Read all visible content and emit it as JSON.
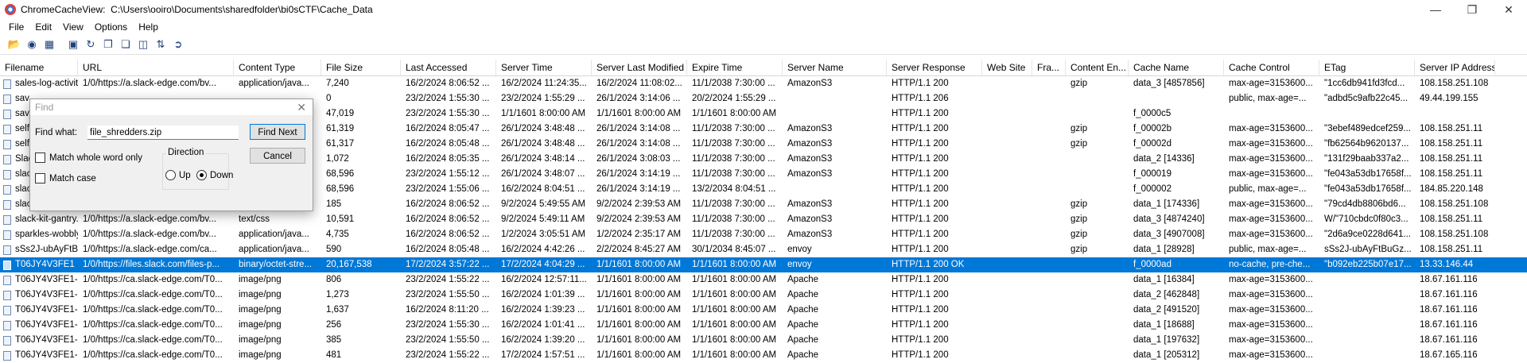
{
  "window": {
    "app_name": "ChromeCacheView:",
    "path": "C:\\Users\\ooiro\\Documents\\sharedfolder\\bi0sCTF\\Cache_Data",
    "minimize": "—",
    "maximize": "❐",
    "close": "✕"
  },
  "menu": [
    "File",
    "Edit",
    "View",
    "Options",
    "Help"
  ],
  "toolbar_icons": [
    "open-icon",
    "browser-icon",
    "folder-icon",
    "save-icon",
    "refresh-icon",
    "copy-icon",
    "copy-all-icon",
    "properties-icon",
    "sort-icon",
    "exit-icon"
  ],
  "columns": [
    {
      "label": "Filename",
      "w": 98
    },
    {
      "label": "URL",
      "w": 196
    },
    {
      "label": "Content Type",
      "w": 110
    },
    {
      "label": "File Size",
      "w": 100
    },
    {
      "label": "Last Accessed",
      "w": 120
    },
    {
      "label": "Server Time",
      "w": 120
    },
    {
      "label": "Server Last Modified",
      "w": 120
    },
    {
      "label": "Expire Time",
      "w": 120
    },
    {
      "label": "Server Name",
      "w": 131
    },
    {
      "label": "Server Response",
      "w": 120
    },
    {
      "label": "Web Site",
      "w": 63
    },
    {
      "label": "Fra...",
      "w": 42
    },
    {
      "label": "Content En...",
      "w": 79
    },
    {
      "label": "Cache Name",
      "w": 120
    },
    {
      "label": "Cache Control",
      "w": 120
    },
    {
      "label": "ETag",
      "w": 120
    },
    {
      "label": "Server IP Address",
      "w": 101
    }
  ],
  "rows": [
    {
      "sel": false,
      "cells": [
        "sales-log-activit...",
        "1/0/https://a.slack-edge.com/bv...",
        "application/java...",
        "7,240",
        "16/2/2024 8:06:52 ...",
        "16/2/2024 11:24:35...",
        "16/2/2024 11:08:02...",
        "11/1/2038 7:30:00 ...",
        "AmazonS3",
        "HTTP/1.1 200",
        "",
        "",
        "gzip",
        "data_3 [4857856]",
        "max-age=3153600...",
        "\"1cc6db941fd3fcd...",
        "108.158.251.108"
      ]
    },
    {
      "sel": false,
      "cells": [
        "sav",
        "",
        "",
        "0",
        "23/2/2024 1:55:30 ...",
        "23/2/2024 1:55:29 ...",
        "26/1/2024 3:14:06 ...",
        "20/2/2024 1:55:29 ...",
        "",
        "HTTP/1.1 206",
        "",
        "",
        "",
        "",
        "public, max-age=...",
        "\"adbd5c9afb22c45...",
        "49.44.199.155"
      ]
    },
    {
      "sel": false,
      "cells": [
        "sav",
        "",
        "",
        "47,019",
        "23/2/2024 1:55:30 ...",
        "1/1/1601 8:00:00 AM",
        "1/1/1601 8:00:00 AM",
        "1/1/1601 8:00:00 AM",
        "",
        "HTTP/1.1 200",
        "",
        "",
        "",
        "f_0000c5",
        "",
        "",
        ""
      ]
    },
    {
      "sel": false,
      "cells": [
        "self",
        "",
        "ava...",
        "61,319",
        "16/2/2024 8:05:47 ...",
        "26/1/2024 3:48:48 ...",
        "26/1/2024 3:14:08 ...",
        "11/1/2038 7:30:00 ...",
        "AmazonS3",
        "HTTP/1.1 200",
        "",
        "",
        "gzip",
        "f_00002b",
        "max-age=3153600...",
        "\"3ebef489edcef259...",
        "108.158.251.11"
      ]
    },
    {
      "sel": false,
      "cells": [
        "self",
        "",
        "ava...",
        "61,317",
        "16/2/2024 8:05:48 ...",
        "26/1/2024 3:48:48 ...",
        "26/1/2024 3:14:08 ...",
        "11/1/2038 7:30:00 ...",
        "AmazonS3",
        "HTTP/1.1 200",
        "",
        "",
        "gzip",
        "f_00002d",
        "max-age=3153600...",
        "\"fb62564b9620137...",
        "108.158.251.11"
      ]
    },
    {
      "sel": false,
      "cells": [
        "Slad",
        "",
        "",
        "1,072",
        "16/2/2024 8:05:35 ...",
        "26/1/2024 3:48:14 ...",
        "26/1/2024 3:08:03 ...",
        "11/1/2038 7:30:00 ...",
        "AmazonS3",
        "HTTP/1.1 200",
        "",
        "",
        "",
        "data_2 [14336]",
        "max-age=3153600...",
        "\"131f29baab337a2...",
        "108.158.251.11"
      ]
    },
    {
      "sel": false,
      "cells": [
        "slac",
        "",
        "",
        "68,596",
        "23/2/2024 1:55:12 ...",
        "26/1/2024 3:48:07 ...",
        "26/1/2024 3:14:19 ...",
        "11/1/2038 7:30:00 ...",
        "AmazonS3",
        "HTTP/1.1 200",
        "",
        "",
        "",
        "f_000019",
        "max-age=3153600...",
        "\"fe043a53db17658f...",
        "108.158.251.11"
      ]
    },
    {
      "sel": false,
      "cells": [
        "slac",
        "",
        "",
        "68,596",
        "23/2/2024 1:55:06 ...",
        "16/2/2024 8:04:51 ...",
        "26/1/2024 3:14:19 ...",
        "13/2/2034 8:04:51 ...",
        "",
        "HTTP/1.1 200",
        "",
        "",
        "",
        "f_000002",
        "public, max-age=...",
        "\"fe043a53db17658f...",
        "184.85.220.148"
      ]
    },
    {
      "sel": false,
      "cells": [
        "slac",
        "",
        "ava...",
        "185",
        "16/2/2024 8:06:52 ...",
        "9/2/2024 5:49:55 AM",
        "9/2/2024 2:39:53 AM",
        "11/1/2038 7:30:00 ...",
        "AmazonS3",
        "HTTP/1.1 200",
        "",
        "",
        "gzip",
        "data_1 [174336]",
        "max-age=3153600...",
        "\"79cd4db8806bd6...",
        "108.158.251.108"
      ]
    },
    {
      "sel": false,
      "cells": [
        "slack-kit-gantry...",
        "1/0/https://a.slack-edge.com/bv...",
        "text/css",
        "10,591",
        "16/2/2024 8:06:52 ...",
        "9/2/2024 5:49:11 AM",
        "9/2/2024 2:39:53 AM",
        "11/1/2038 7:30:00 ...",
        "AmazonS3",
        "HTTP/1.1 200",
        "",
        "",
        "gzip",
        "data_3 [4874240]",
        "max-age=3153600...",
        "W/\"710cbdc0f80c3...",
        "108.158.251.11"
      ]
    },
    {
      "sel": false,
      "cells": [
        "sparkles-wobbly...",
        "1/0/https://a.slack-edge.com/bv...",
        "application/java...",
        "4,735",
        "16/2/2024 8:06:52 ...",
        "1/2/2024 3:05:51 AM",
        "1/2/2024 2:35:17 AM",
        "11/1/2038 7:30:00 ...",
        "AmazonS3",
        "HTTP/1.1 200",
        "",
        "",
        "gzip",
        "data_3 [4907008]",
        "max-age=3153600...",
        "\"2d6a9ce0228d641...",
        "108.158.251.108"
      ]
    },
    {
      "sel": false,
      "cells": [
        "sSs2J-ubAyFtBu...",
        "1/0/https://a.slack-edge.com/ca...",
        "application/java...",
        "590",
        "16/2/2024 8:05:48 ...",
        "16/2/2024 4:42:26 ...",
        "2/2/2024 8:45:27 AM",
        "30/1/2034 8:45:07 ...",
        "envoy",
        "HTTP/1.1 200",
        "",
        "",
        "gzip",
        "data_1 [28928]",
        "public, max-age=...",
        "sSs2J-ubAyFtBuGz...",
        "108.158.251.11"
      ]
    },
    {
      "sel": true,
      "cells": [
        "T06JY4V3FE1",
        "1/0/https://files.slack.com/files-p...",
        "binary/octet-stre...",
        "20,167,538",
        "17/2/2024 3:57:22 ...",
        "17/2/2024 4:04:29 ...",
        "1/1/1601 8:00:00 AM",
        "1/1/1601 8:00:00 AM",
        "envoy",
        "HTTP/1.1 200 OK",
        "",
        "",
        "",
        "f_0000ad",
        "no-cache, pre-che...",
        "\"b092eb225b07e17...",
        "13.33.146.44"
      ]
    },
    {
      "sel": false,
      "cells": [
        "T06JY4V3FE1-U0...",
        "1/0/https://ca.slack-edge.com/T0...",
        "image/png",
        "806",
        "23/2/2024 1:55:22 ...",
        "16/2/2024 12:57:11...",
        "1/1/1601 8:00:00 AM",
        "1/1/1601 8:00:00 AM",
        "Apache",
        "HTTP/1.1 200",
        "",
        "",
        "",
        "data_1 [16384]",
        "max-age=3153600...",
        "",
        "18.67.161.116"
      ]
    },
    {
      "sel": false,
      "cells": [
        "T06JY4V3FE1-U0...",
        "1/0/https://ca.slack-edge.com/T0...",
        "image/png",
        "1,273",
        "23/2/2024 1:55:50 ...",
        "16/2/2024 1:01:39 ...",
        "1/1/1601 8:00:00 AM",
        "1/1/1601 8:00:00 AM",
        "Apache",
        "HTTP/1.1 200",
        "",
        "",
        "",
        "data_2 [462848]",
        "max-age=3153600...",
        "",
        "18.67.161.116"
      ]
    },
    {
      "sel": false,
      "cells": [
        "T06JY4V3FE1-U0...",
        "1/0/https://ca.slack-edge.com/T0...",
        "image/png",
        "1,637",
        "16/2/2024 8:11:20 ...",
        "16/2/2024 1:39:23 ...",
        "1/1/1601 8:00:00 AM",
        "1/1/1601 8:00:00 AM",
        "Apache",
        "HTTP/1.1 200",
        "",
        "",
        "",
        "data_2 [491520]",
        "max-age=3153600...",
        "",
        "18.67.161.116"
      ]
    },
    {
      "sel": false,
      "cells": [
        "T06JY4V3FE1-U0...",
        "1/0/https://ca.slack-edge.com/T0...",
        "image/png",
        "256",
        "23/2/2024 1:55:30 ...",
        "16/2/2024 1:01:41 ...",
        "1/1/1601 8:00:00 AM",
        "1/1/1601 8:00:00 AM",
        "Apache",
        "HTTP/1.1 200",
        "",
        "",
        "",
        "data_1 [18688]",
        "max-age=3153600...",
        "",
        "18.67.161.116"
      ]
    },
    {
      "sel": false,
      "cells": [
        "T06JY4V3FE1-U0...",
        "1/0/https://ca.slack-edge.com/T0...",
        "image/png",
        "385",
        "23/2/2024 1:55:50 ...",
        "16/2/2024 1:39:20 ...",
        "1/1/1601 8:00:00 AM",
        "1/1/1601 8:00:00 AM",
        "Apache",
        "HTTP/1.1 200",
        "",
        "",
        "",
        "data_1 [197632]",
        "max-age=3153600...",
        "",
        "18.67.161.116"
      ]
    },
    {
      "sel": false,
      "cells": [
        "T06JY4V3FE1-U0...",
        "1/0/https://ca.slack-edge.com/T0...",
        "image/png",
        "481",
        "23/2/2024 1:55:22 ...",
        "17/2/2024 1:57:51 ...",
        "1/1/1601 8:00:00 AM",
        "1/1/1601 8:00:00 AM",
        "Apache",
        "HTTP/1.1 200",
        "",
        "",
        "",
        "data_1 [205312]",
        "max-age=3153600...",
        "",
        "18.67.165.116"
      ]
    }
  ],
  "find_dialog": {
    "title": "Find",
    "find_what_label": "Find what:",
    "find_what_value": "file_shredders.zip",
    "find_next": "Find Next",
    "cancel": "Cancel",
    "match_whole_word": "Match whole word only",
    "match_case": "Match case",
    "direction_label": "Direction",
    "up": "Up",
    "down": "Down",
    "direction_selected": "Down"
  }
}
